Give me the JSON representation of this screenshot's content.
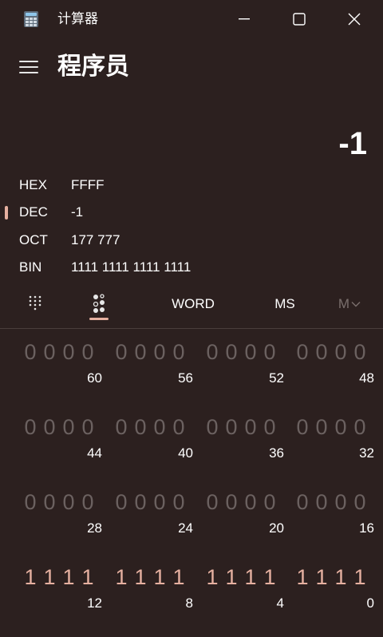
{
  "titlebar": {
    "app_title": "计算器",
    "app_icon": "calculator-icon",
    "minimize_icon": "minimize-icon",
    "maximize_icon": "maximize-icon",
    "close_icon": "close-icon"
  },
  "header": {
    "menu_icon": "hamburger-menu-icon",
    "mode_title": "程序员"
  },
  "display": {
    "value": "-1"
  },
  "radix": [
    {
      "label": "HEX",
      "value": "FFFF",
      "selected": false
    },
    {
      "label": "DEC",
      "value": "-1",
      "selected": true
    },
    {
      "label": "OCT",
      "value": "177 777",
      "selected": false
    },
    {
      "label": "BIN",
      "value": "1111 1111 1111 1111",
      "selected": false
    }
  ],
  "toolbar": {
    "keypad_icon": "full-keypad-icon",
    "bit_toggle_icon": "bit-toggling-keypad-icon",
    "word_label": "WORD",
    "ms_label": "MS",
    "memory_label": "M",
    "memory_chevron": "chevron-down-icon"
  },
  "bit_grid": [
    {
      "bits": "0000",
      "index": "60",
      "active": false
    },
    {
      "bits": "0000",
      "index": "56",
      "active": false
    },
    {
      "bits": "0000",
      "index": "52",
      "active": false
    },
    {
      "bits": "0000",
      "index": "48",
      "active": false
    },
    {
      "bits": "0000",
      "index": "44",
      "active": false
    },
    {
      "bits": "0000",
      "index": "40",
      "active": false
    },
    {
      "bits": "0000",
      "index": "36",
      "active": false
    },
    {
      "bits": "0000",
      "index": "32",
      "active": false
    },
    {
      "bits": "0000",
      "index": "28",
      "active": false
    },
    {
      "bits": "0000",
      "index": "24",
      "active": false
    },
    {
      "bits": "0000",
      "index": "20",
      "active": false
    },
    {
      "bits": "0000",
      "index": "16",
      "active": false
    },
    {
      "bits": "1111",
      "index": "12",
      "active": true
    },
    {
      "bits": "1111",
      "index": "8",
      "active": true
    },
    {
      "bits": "1111",
      "index": "4",
      "active": true
    },
    {
      "bits": "1111",
      "index": "0",
      "active": true
    }
  ],
  "colors": {
    "background": "#2c201f",
    "accent": "#e6b0a0",
    "inactive_bit": "#6b6160",
    "text": "#ffffff"
  }
}
